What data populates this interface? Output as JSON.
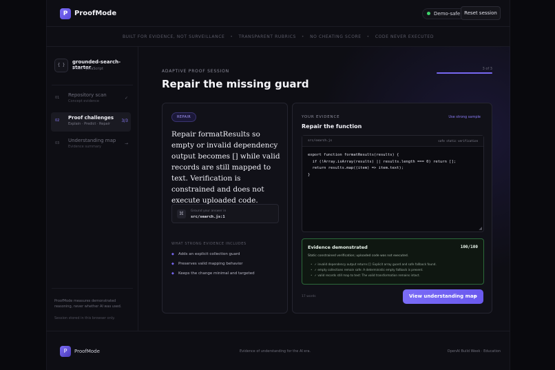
{
  "header": {
    "logo_letter": "P",
    "brand": "ProofMode",
    "status": "Demo-safe",
    "reset_label": "Reset session"
  },
  "tagline": [
    "BUILT FOR EVIDENCE, NOT SURVEILLANCE",
    "TRANSPARENT RUBRICS",
    "NO CHEATING SCORE",
    "CODE NEVER EXECUTED"
  ],
  "tagline_sep": "•",
  "sidebar": {
    "repo_icon": "{ }",
    "repo_name": "grounded-search-starter",
    "repo_meta": "3 files · JavaScript",
    "steps": [
      {
        "num": "01",
        "title": "Repository scan",
        "sub": "Concept evidence",
        "mark": "✓"
      },
      {
        "num": "02",
        "title": "Proof challenges",
        "sub": "Explain · Predict · Repair",
        "mark": "3/3"
      },
      {
        "num": "03",
        "title": "Understanding map",
        "sub": "Evidence summary",
        "mark": "→"
      }
    ],
    "note": "ProofMode measures demonstrated reasoning, never whether AI was used.",
    "note2": "Session stored in this browser only."
  },
  "main": {
    "eyebrow": "ADAPTIVE PROOF SESSION",
    "title": "Repair the missing guard",
    "progress_label": "3 of 3",
    "progress_fraction": 1.0
  },
  "challenge": {
    "tag": "REPAIR",
    "prompt": "Repair formatResults so empty or invalid dependency output becomes [] while valid records are still mapped to text. Verification is constrained and does not execute uploaded code.",
    "ground_icon": "⌘",
    "ground_label": "Ground your answer in",
    "ground_path": "src/search.js:1",
    "strong_heading": "WHAT STRONG EVIDENCE INCLUDES",
    "strong_items": [
      "Adds an explicit collection guard",
      "Preserves valid mapping behavior",
      "Keeps the change minimal and targeted"
    ],
    "bullet": "◆"
  },
  "evidence": {
    "eyebrow": "YOUR EVIDENCE",
    "use_sample": "Use strong sample",
    "title": "Repair the function",
    "file": "src/search.js",
    "badge": "safe static verification",
    "code": "export function formatResults(results) {\n  if (!Array.isArray(results) || results.length === 0) return [];\n  return results.map((item) => item.text);\n}",
    "resize_icon": "◢",
    "result_title": "Evidence demonstrated",
    "score": "100/100",
    "result_line": "Static constrained verification; uploaded code was not executed.",
    "checks": [
      "✓ invalid dependency output returns []: Explicit array guard and safe fallback found.",
      "✓ empty collections remain safe: A deterministic empty fallback is present.",
      "✓ valid records still map to text: The valid transformation remains intact."
    ],
    "check_bullet": "•",
    "word_count": "17 words",
    "cta_label": "View understanding map",
    "cta_arrow": "→"
  },
  "footer": {
    "logo_letter": "P",
    "brand": "ProofMode",
    "tagline": "Evidence of understanding for the AI era.",
    "right": "OpenAI Build Week · Education"
  }
}
